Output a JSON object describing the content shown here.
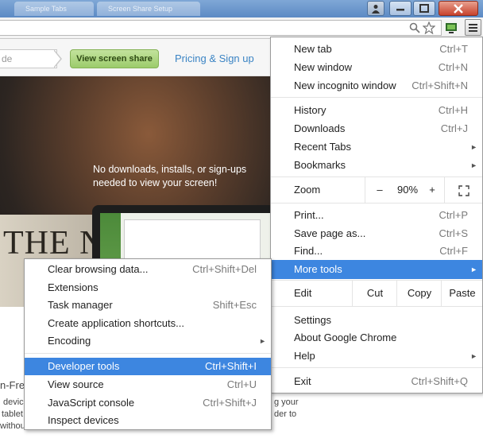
{
  "browser": {
    "tabs": [
      {
        "label": "Sample Tabs"
      },
      {
        "label": "Screen Share Setup"
      }
    ]
  },
  "page": {
    "crumb_text": "de",
    "view_button": "View screen share",
    "pricing_link": "Pricing & Sign up",
    "hero_line1": "No downloads, installs, or sign-ups",
    "hero_line2": "needed to view your screen!",
    "paper_text": "THE N",
    "frag_heading": "n-Fre",
    "frag_left": [
      "devic",
      "tablet",
      "withou"
    ],
    "frag_right": [
      "g your",
      "der to"
    ]
  },
  "menu": {
    "group1": [
      {
        "label": "New tab",
        "shortcut": "Ctrl+T"
      },
      {
        "label": "New window",
        "shortcut": "Ctrl+N"
      },
      {
        "label": "New incognito window",
        "shortcut": "Ctrl+Shift+N"
      }
    ],
    "group2": [
      {
        "label": "History",
        "shortcut": "Ctrl+H"
      },
      {
        "label": "Downloads",
        "shortcut": "Ctrl+J"
      },
      {
        "label": "Recent Tabs"
      },
      {
        "label": "Bookmarks"
      }
    ],
    "zoom": {
      "label": "Zoom",
      "minus": "–",
      "value": "90%",
      "plus": "+"
    },
    "group3": [
      {
        "label": "Print...",
        "shortcut": "Ctrl+P"
      },
      {
        "label": "Save page as...",
        "shortcut": "Ctrl+S"
      },
      {
        "label": "Find...",
        "shortcut": "Ctrl+F"
      },
      {
        "label": "More tools"
      }
    ],
    "edit": {
      "label": "Edit",
      "cut": "Cut",
      "copy": "Copy",
      "paste": "Paste"
    },
    "group4": [
      {
        "label": "Settings"
      },
      {
        "label": "About Google Chrome"
      },
      {
        "label": "Help"
      }
    ],
    "exit": {
      "label": "Exit",
      "shortcut": "Ctrl+Shift+Q"
    }
  },
  "submenu": {
    "group1": [
      {
        "label": "Clear browsing data...",
        "shortcut": "Ctrl+Shift+Del"
      },
      {
        "label": "Extensions"
      },
      {
        "label": "Task manager",
        "shortcut": "Shift+Esc"
      },
      {
        "label": "Create application shortcuts..."
      },
      {
        "label": "Encoding"
      }
    ],
    "group2": [
      {
        "label": "Developer tools",
        "shortcut": "Ctrl+Shift+I"
      },
      {
        "label": "View source",
        "shortcut": "Ctrl+U"
      },
      {
        "label": "JavaScript console",
        "shortcut": "Ctrl+Shift+J"
      },
      {
        "label": "Inspect devices"
      }
    ]
  },
  "colors": {
    "highlight": "#3d86e0",
    "link": "#3b84c4",
    "button_green": "#9ccb6b"
  }
}
